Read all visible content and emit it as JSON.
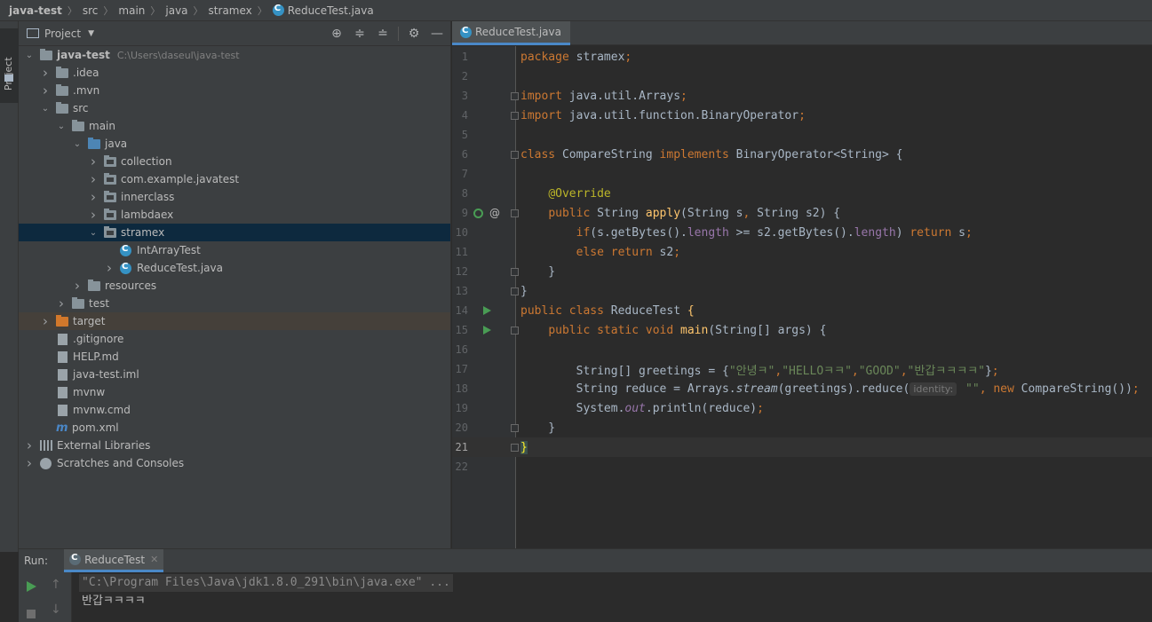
{
  "breadcrumb": [
    "java-test",
    "src",
    "main",
    "java",
    "stramex",
    "ReduceTest.java"
  ],
  "left_strip": {
    "label": "Project"
  },
  "project_panel": {
    "title": "Project",
    "tools": [
      "locate-icon",
      "expand-all-icon",
      "collapse-all-icon",
      "gear-icon",
      "minimize-icon"
    ]
  },
  "tree": [
    {
      "label": "java-test",
      "path": "C:\\Users\\daseul\\java-test",
      "depth": 0,
      "arrow": "down",
      "icon": "module",
      "bold": true
    },
    {
      "label": ".idea",
      "depth": 1,
      "arrow": "right",
      "icon": "folder"
    },
    {
      "label": ".mvn",
      "depth": 1,
      "arrow": "right",
      "icon": "folder"
    },
    {
      "label": "src",
      "depth": 1,
      "arrow": "down",
      "icon": "folder"
    },
    {
      "label": "main",
      "depth": 2,
      "arrow": "down",
      "icon": "folder"
    },
    {
      "label": "java",
      "depth": 3,
      "arrow": "down",
      "icon": "folder-blue"
    },
    {
      "label": "collection",
      "depth": 4,
      "arrow": "right",
      "icon": "package"
    },
    {
      "label": "com.example.javatest",
      "depth": 4,
      "arrow": "right",
      "icon": "package"
    },
    {
      "label": "innerclass",
      "depth": 4,
      "arrow": "right",
      "icon": "package"
    },
    {
      "label": "lambdaex",
      "depth": 4,
      "arrow": "right",
      "icon": "package"
    },
    {
      "label": "stramex",
      "depth": 4,
      "arrow": "down",
      "icon": "package",
      "selected": true
    },
    {
      "label": "IntArrayTest",
      "depth": 5,
      "arrow": "none",
      "icon": "class"
    },
    {
      "label": "ReduceTest.java",
      "depth": 5,
      "arrow": "right",
      "icon": "class"
    },
    {
      "label": "resources",
      "depth": 3,
      "arrow": "right",
      "icon": "folder-res"
    },
    {
      "label": "test",
      "depth": 2,
      "arrow": "right",
      "icon": "folder"
    },
    {
      "label": "target",
      "depth": 1,
      "arrow": "right",
      "icon": "folder-orange",
      "target": true
    },
    {
      "label": ".gitignore",
      "depth": 1,
      "arrow": "none",
      "icon": "file"
    },
    {
      "label": "HELP.md",
      "depth": 1,
      "arrow": "none",
      "icon": "file"
    },
    {
      "label": "java-test.iml",
      "depth": 1,
      "arrow": "none",
      "icon": "file"
    },
    {
      "label": "mvnw",
      "depth": 1,
      "arrow": "none",
      "icon": "file"
    },
    {
      "label": "mvnw.cmd",
      "depth": 1,
      "arrow": "none",
      "icon": "file"
    },
    {
      "label": "pom.xml",
      "depth": 1,
      "arrow": "none",
      "icon": "maven"
    },
    {
      "label": "External Libraries",
      "depth": 0,
      "arrow": "right",
      "icon": "library"
    },
    {
      "label": "Scratches and Consoles",
      "depth": 0,
      "arrow": "right",
      "icon": "scratch"
    }
  ],
  "editor": {
    "tab_label": "ReduceTest.java",
    "current_line": 21,
    "lines": [
      [
        {
          "t": "package ",
          "c": "kw"
        },
        {
          "t": "stramex"
        },
        {
          "t": ";",
          "c": "kw"
        }
      ],
      [],
      [
        {
          "t": "import ",
          "c": "kw"
        },
        {
          "t": "java.util.Arrays"
        },
        {
          "t": ";",
          "c": "kw"
        }
      ],
      [
        {
          "t": "import ",
          "c": "kw"
        },
        {
          "t": "java.util.function.BinaryOperator"
        },
        {
          "t": ";",
          "c": "kw"
        }
      ],
      [],
      [
        {
          "t": "class ",
          "c": "kw"
        },
        {
          "t": "CompareString "
        },
        {
          "t": "implements ",
          "c": "kw"
        },
        {
          "t": "BinaryOperator<String> {"
        }
      ],
      [],
      [
        {
          "t": "    "
        },
        {
          "t": "@Override",
          "c": "ann"
        }
      ],
      [
        {
          "t": "    "
        },
        {
          "t": "public ",
          "c": "kw"
        },
        {
          "t": "String "
        },
        {
          "t": "apply",
          "c": "fn"
        },
        {
          "t": "(String s"
        },
        {
          "t": ", ",
          "c": "kw"
        },
        {
          "t": "String s2) {"
        }
      ],
      [
        {
          "t": "        "
        },
        {
          "t": "if",
          "c": "kw"
        },
        {
          "t": "(s.getBytes()."
        },
        {
          "t": "length",
          "c": "fld"
        },
        {
          "t": " >= s2.getBytes()."
        },
        {
          "t": "length",
          "c": "fld"
        },
        {
          "t": ") "
        },
        {
          "t": "return ",
          "c": "kw"
        },
        {
          "t": "s"
        },
        {
          "t": ";",
          "c": "kw"
        }
      ],
      [
        {
          "t": "        "
        },
        {
          "t": "else return ",
          "c": "kw"
        },
        {
          "t": "s2"
        },
        {
          "t": ";",
          "c": "kw"
        }
      ],
      [
        {
          "t": "    }"
        }
      ],
      [
        {
          "t": "}"
        }
      ],
      [
        {
          "t": "public class ",
          "c": "kw"
        },
        {
          "t": "ReduceTest "
        },
        {
          "t": "{",
          "c": "fn"
        }
      ],
      [
        {
          "t": "    "
        },
        {
          "t": "public static void ",
          "c": "kw"
        },
        {
          "t": "main",
          "c": "fn"
        },
        {
          "t": "(String[] args) {"
        }
      ],
      [],
      [
        {
          "t": "        String[] greetings = {"
        },
        {
          "t": "\"안녕ㅋ\"",
          "c": "str"
        },
        {
          "t": ",",
          "c": "kw"
        },
        {
          "t": "\"HELLOㅋㅋ\"",
          "c": "str"
        },
        {
          "t": ",",
          "c": "kw"
        },
        {
          "t": "\"GOOD\"",
          "c": "str"
        },
        {
          "t": ",",
          "c": "kw"
        },
        {
          "t": "\"반갑ㅋㅋㅋㅋ\"",
          "c": "str"
        },
        {
          "t": "}"
        },
        {
          "t": ";",
          "c": "kw"
        }
      ],
      [
        {
          "t": "        String reduce = Arrays."
        },
        {
          "t": "stream",
          "c": "ital"
        },
        {
          "t": "(greetings).reduce("
        },
        {
          "t": "identity:",
          "c": "hint"
        },
        {
          "t": " "
        },
        {
          "t": "\"\"",
          "c": "str"
        },
        {
          "t": ", ",
          "c": "kw"
        },
        {
          "t": "new ",
          "c": "kw"
        },
        {
          "t": "CompareString())"
        },
        {
          "t": ";",
          "c": "kw"
        }
      ],
      [
        {
          "t": "        System."
        },
        {
          "t": "out",
          "c": "fld ital"
        },
        {
          "t": ".println(reduce)"
        },
        {
          "t": ";",
          "c": "kw"
        }
      ],
      [
        {
          "t": "    }"
        }
      ],
      [
        {
          "t": "}",
          "c": "brace-hl"
        }
      ],
      []
    ],
    "gutter": {
      "fold_lines": [
        3,
        4,
        6,
        9,
        12,
        13,
        15,
        20,
        21
      ],
      "run_lines": [
        14,
        15
      ],
      "override_line": 9
    }
  },
  "run_panel": {
    "label": "Run:",
    "tab": "ReduceTest",
    "command": "\"C:\\Program Files\\Java\\jdk1.8.0_291\\bin\\java.exe\" ...",
    "output": "반갑ㅋㅋㅋㅋ"
  }
}
